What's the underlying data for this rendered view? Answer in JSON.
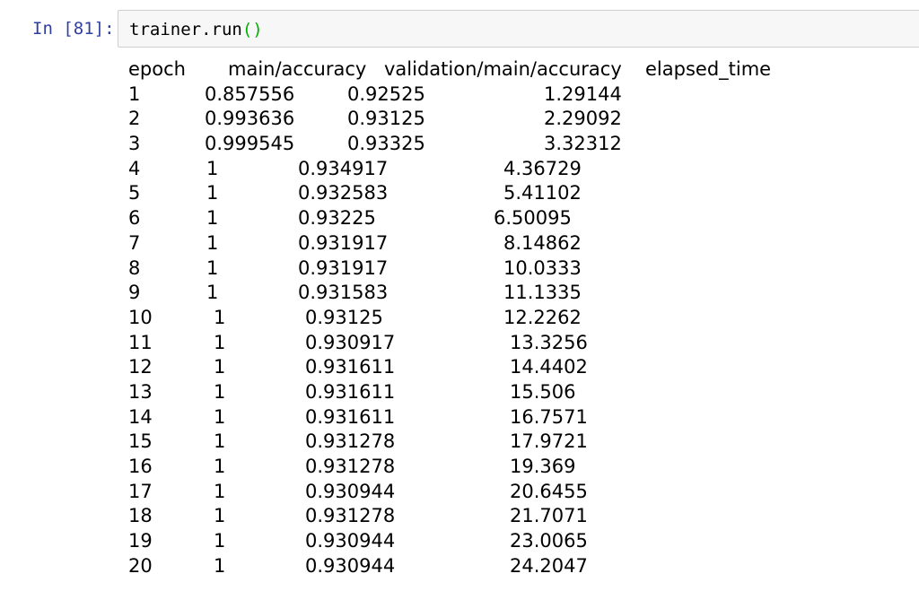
{
  "cell": {
    "prompt": "In [81]:",
    "code_prefix": "trainer.run",
    "code_open": "(",
    "code_close": ")"
  },
  "output": {
    "header": {
      "epoch": "epoch",
      "main_accuracy": "main/accuracy",
      "validation_main_accuracy": "validation/main/accuracy",
      "elapsed_time": "elapsed_time"
    },
    "rows": [
      {
        "epoch": "1",
        "main_accuracy": "0.857556",
        "validation_main_accuracy": "0.92525",
        "elapsed_time": "1.29144"
      },
      {
        "epoch": "2",
        "main_accuracy": "0.993636",
        "validation_main_accuracy": "0.93125",
        "elapsed_time": "2.29092"
      },
      {
        "epoch": "3",
        "main_accuracy": "0.999545",
        "validation_main_accuracy": "0.93325",
        "elapsed_time": "3.32312"
      },
      {
        "epoch": "4",
        "main_accuracy": "1",
        "validation_main_accuracy": "0.934917",
        "elapsed_time": "4.36729"
      },
      {
        "epoch": "5",
        "main_accuracy": "1",
        "validation_main_accuracy": "0.932583",
        "elapsed_time": "5.41102"
      },
      {
        "epoch": "6",
        "main_accuracy": "1",
        "validation_main_accuracy": "0.93225",
        "elapsed_time": "6.50095"
      },
      {
        "epoch": "7",
        "main_accuracy": "1",
        "validation_main_accuracy": "0.931917",
        "elapsed_time": "8.14862"
      },
      {
        "epoch": "8",
        "main_accuracy": "1",
        "validation_main_accuracy": "0.931917",
        "elapsed_time": "10.0333"
      },
      {
        "epoch": "9",
        "main_accuracy": "1",
        "validation_main_accuracy": "0.931583",
        "elapsed_time": "11.1335"
      },
      {
        "epoch": "10",
        "main_accuracy": "1",
        "validation_main_accuracy": "0.93125",
        "elapsed_time": "12.2262"
      },
      {
        "epoch": "11",
        "main_accuracy": "1",
        "validation_main_accuracy": "0.930917",
        "elapsed_time": "13.3256"
      },
      {
        "epoch": "12",
        "main_accuracy": "1",
        "validation_main_accuracy": "0.931611",
        "elapsed_time": "14.4402"
      },
      {
        "epoch": "13",
        "main_accuracy": "1",
        "validation_main_accuracy": "0.931611",
        "elapsed_time": "15.506"
      },
      {
        "epoch": "14",
        "main_accuracy": "1",
        "validation_main_accuracy": "0.931611",
        "elapsed_time": "16.7571"
      },
      {
        "epoch": "15",
        "main_accuracy": "1",
        "validation_main_accuracy": "0.931278",
        "elapsed_time": "17.9721"
      },
      {
        "epoch": "16",
        "main_accuracy": "1",
        "validation_main_accuracy": "0.931278",
        "elapsed_time": "19.369"
      },
      {
        "epoch": "17",
        "main_accuracy": "1",
        "validation_main_accuracy": "0.930944",
        "elapsed_time": "20.6455"
      },
      {
        "epoch": "18",
        "main_accuracy": "1",
        "validation_main_accuracy": "0.931278",
        "elapsed_time": "21.7071"
      },
      {
        "epoch": "19",
        "main_accuracy": "1",
        "validation_main_accuracy": "0.930944",
        "elapsed_time": "23.0065"
      },
      {
        "epoch": "20",
        "main_accuracy": "1",
        "validation_main_accuracy": "0.930944",
        "elapsed_time": "24.2047"
      }
    ]
  }
}
